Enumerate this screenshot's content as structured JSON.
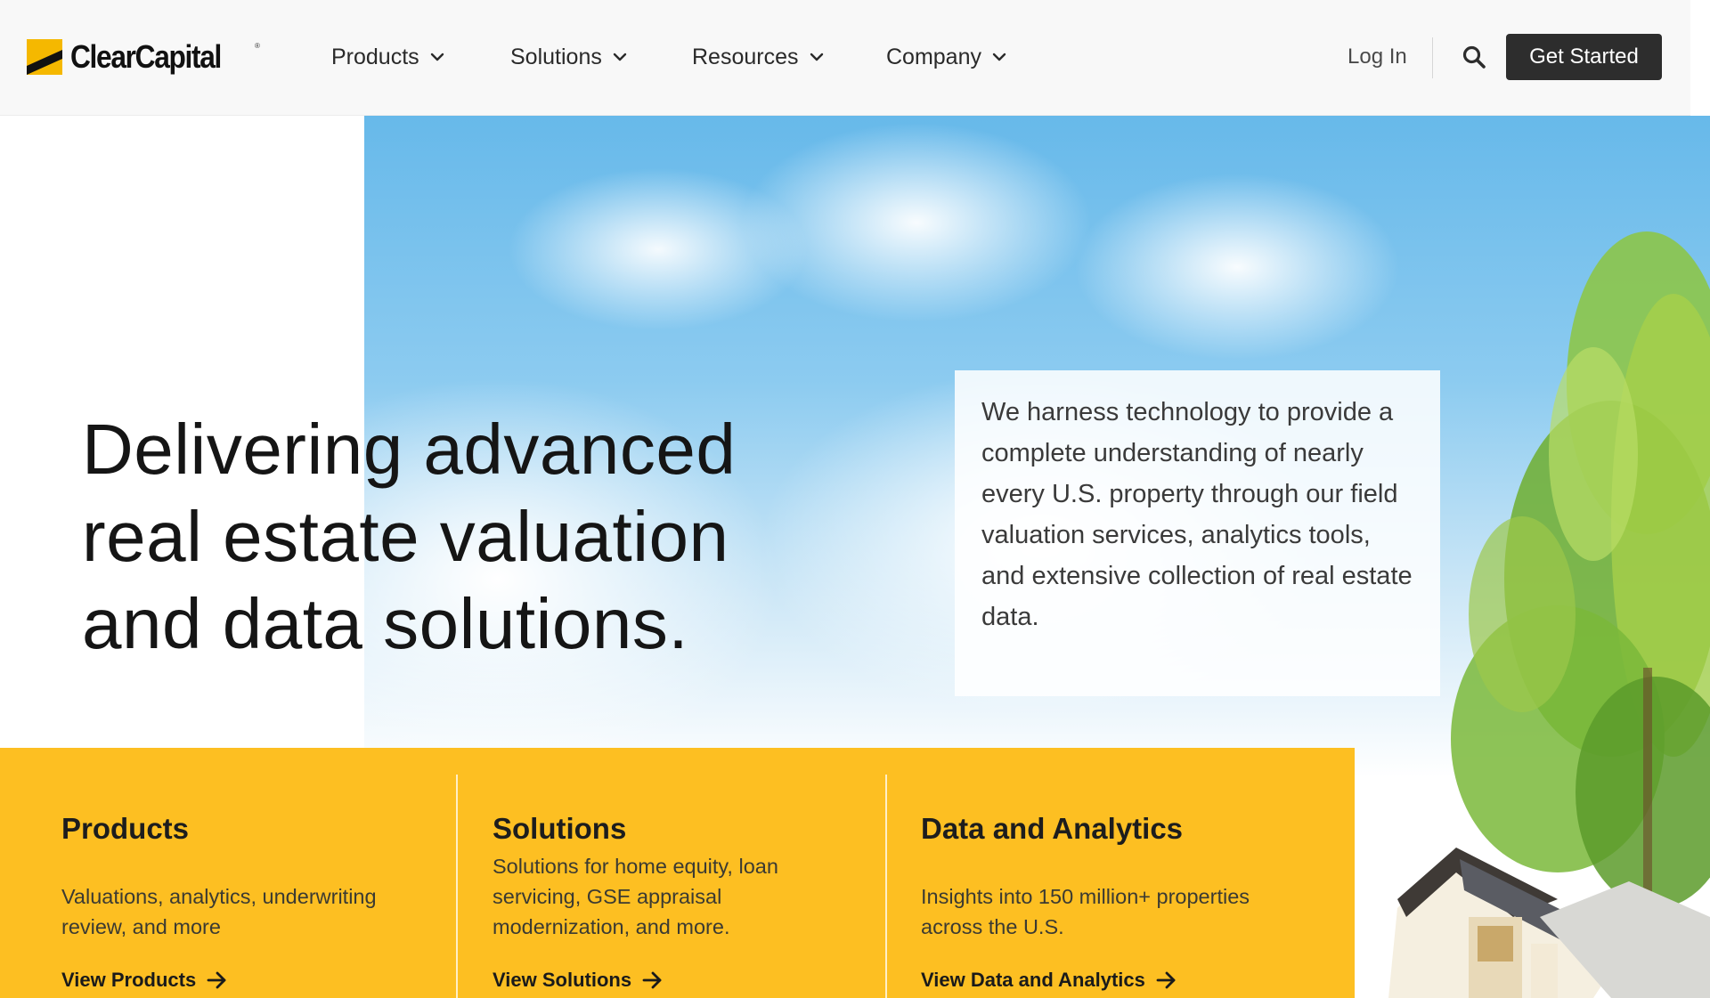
{
  "brand": {
    "name": "ClearCapital",
    "registered_mark": "®",
    "logo_icon": "clear-capital-logo-icon",
    "colors": {
      "accent": "#fdbf22",
      "dark": "#2d2d2d",
      "mark": "#f5b800"
    }
  },
  "nav": {
    "items": [
      {
        "label": "Products",
        "icon": "chevron-down-icon"
      },
      {
        "label": "Solutions",
        "icon": "chevron-down-icon"
      },
      {
        "label": "Resources",
        "icon": "chevron-down-icon"
      },
      {
        "label": "Company",
        "icon": "chevron-down-icon"
      }
    ],
    "login_label": "Log In",
    "search_icon": "search-icon",
    "cta_label": "Get Started"
  },
  "hero": {
    "headline": "Delivering advanced real estate valuation and data solutions.",
    "intro": "We harness technology to provide a complete understanding of nearly every U.S. property through our field valuation services, analytics tools, and extensive collection of real estate data."
  },
  "cards": [
    {
      "title": "Products",
      "description": "Valuations, analytics, underwriting review, and more",
      "link_label": "View Products",
      "link_icon": "arrow-right-icon"
    },
    {
      "title": "Solutions",
      "description": "Solutions for home equity, loan servicing, GSE appraisal modernization, and more.",
      "link_label": "View Solutions",
      "link_icon": "arrow-right-icon"
    },
    {
      "title": "Data and Analytics",
      "description": "Insights into 150 million+ properties across the U.S.",
      "link_label": "View Data and Analytics",
      "link_icon": "arrow-right-icon"
    }
  ]
}
